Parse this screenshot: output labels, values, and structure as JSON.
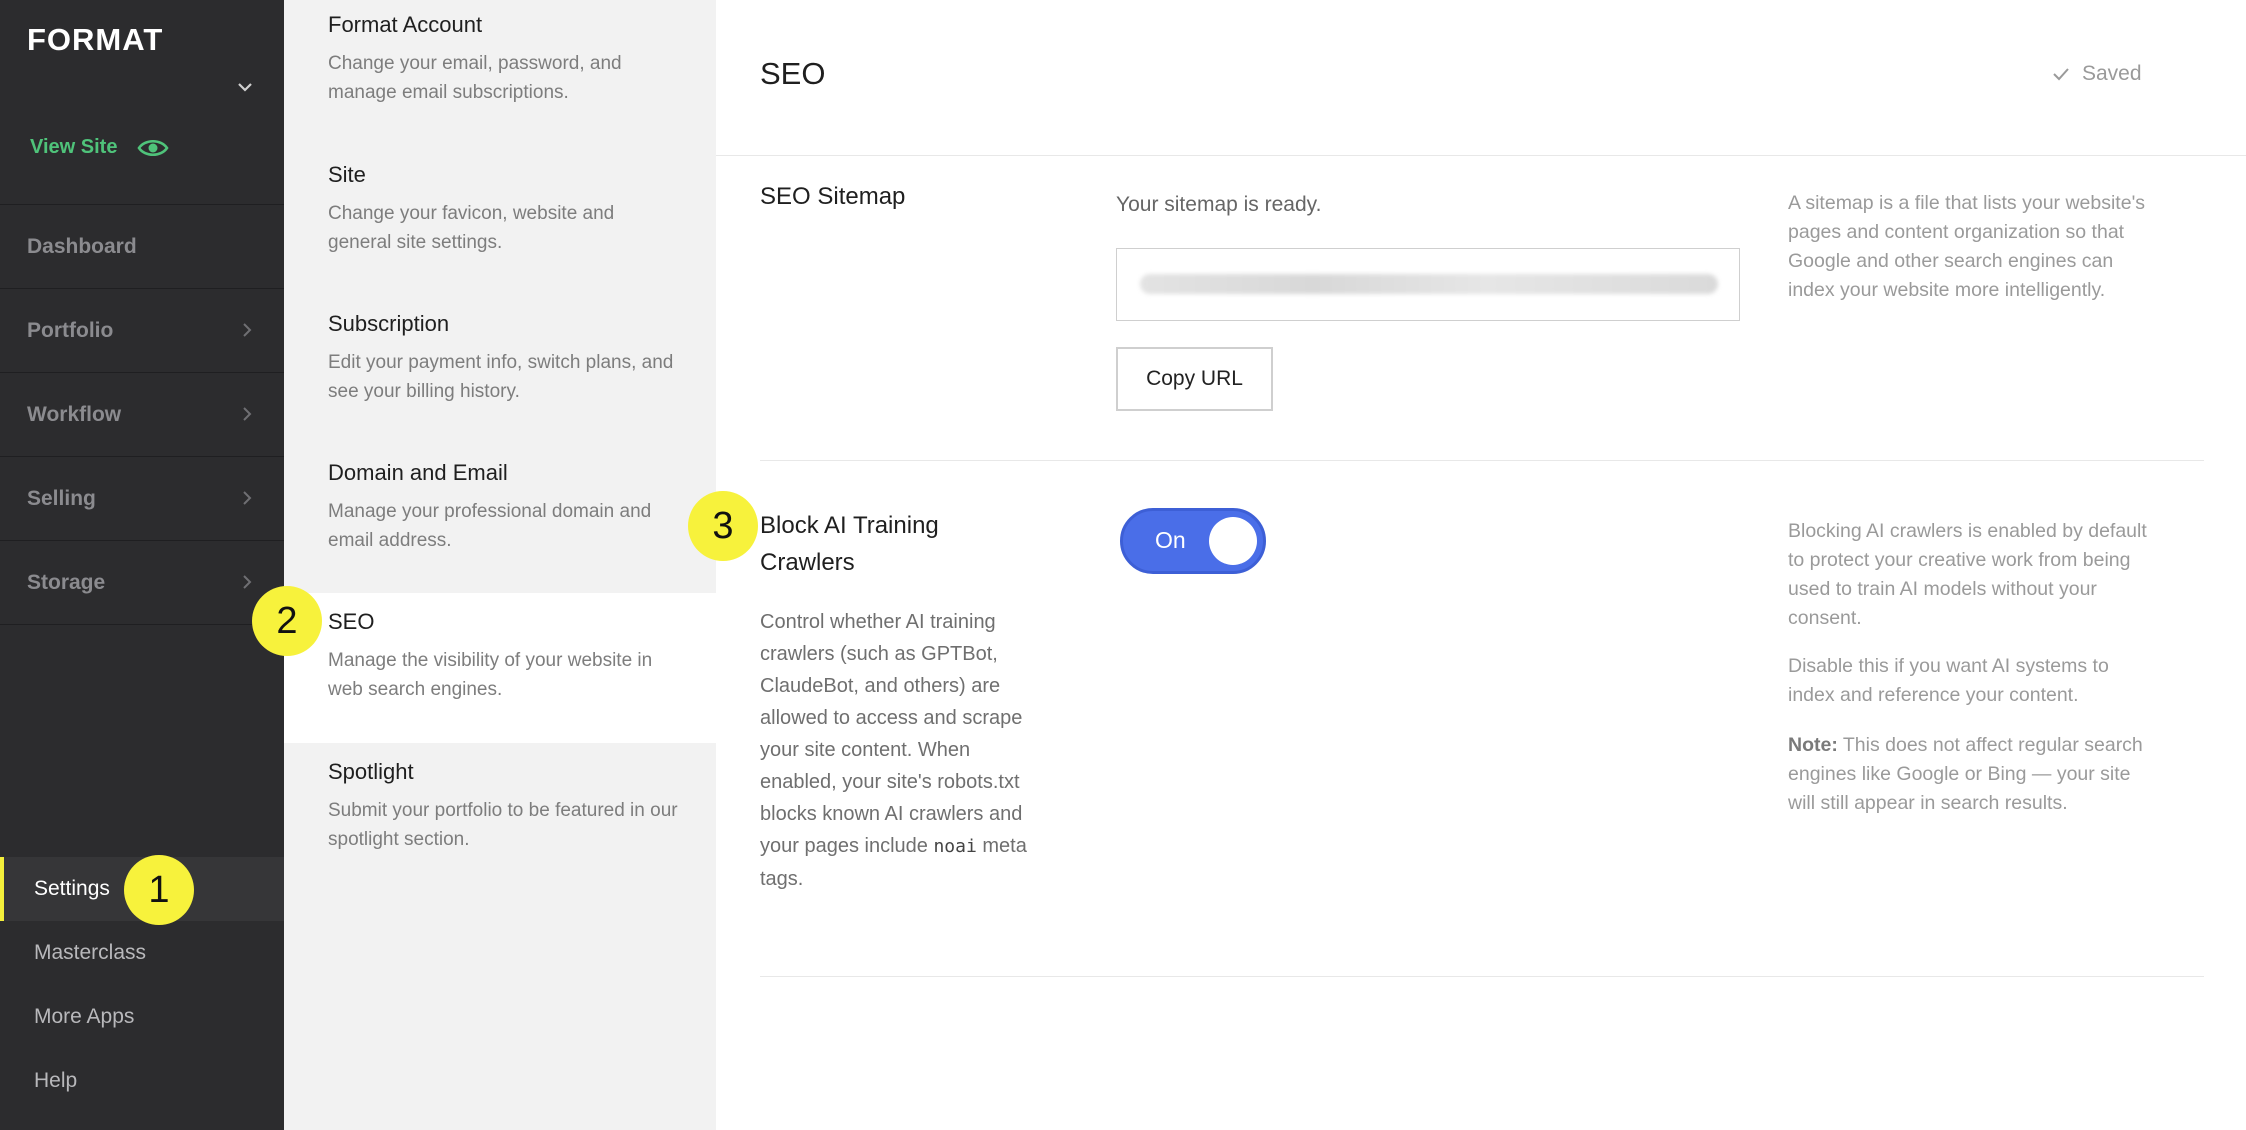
{
  "brand": {
    "logo": "FORMAT",
    "accent_green": "#4fc37a",
    "accent_yellow": "#f4ef3b",
    "toggle_blue": "#4a6ee8"
  },
  "sidebar": {
    "view_site": "View Site",
    "nav": [
      {
        "label": "Dashboard",
        "has_arrow": false
      },
      {
        "label": "Portfolio",
        "has_arrow": true
      },
      {
        "label": "Workflow",
        "has_arrow": true
      },
      {
        "label": "Selling",
        "has_arrow": true
      },
      {
        "label": "Storage",
        "has_arrow": true
      }
    ],
    "bottom": [
      {
        "label": "Settings",
        "active": true
      },
      {
        "label": "Masterclass",
        "active": false
      },
      {
        "label": "More Apps",
        "active": false
      },
      {
        "label": "Help",
        "active": false
      }
    ]
  },
  "settings_menu": [
    {
      "title": "Format Account",
      "desc": "Change your email, password, and manage email subscriptions."
    },
    {
      "title": "Site",
      "desc": "Change your favicon, website and general site settings."
    },
    {
      "title": "Subscription",
      "desc": "Edit your payment info, switch plans, and see your billing history."
    },
    {
      "title": "Domain and Email",
      "desc": "Manage your professional domain and email address."
    },
    {
      "title": "SEO",
      "desc": "Manage the visibility of your website in web search engines.",
      "active": true
    },
    {
      "title": "Spotlight",
      "desc": "Submit your portfolio to be featured in our spotlight section."
    }
  ],
  "main": {
    "title": "SEO",
    "status": "Saved",
    "sitemap": {
      "title": "SEO Sitemap",
      "ready_text": "Your sitemap is ready.",
      "copy_button": "Copy URL",
      "help": "A sitemap is a file that lists your website's pages and content organization so that Google and other search engines can index your website more intelligently."
    },
    "block_ai": {
      "title": "Block AI Training Crawlers",
      "desc_before_code": "Control whether AI training crawlers (such as GPTBot, ClaudeBot, and others) are allowed to access and scrape your site content. When enabled, your site's robots.txt blocks known AI crawlers and your pages include ",
      "code": "noai",
      "desc_after_code": " meta tags.",
      "toggle_label": "On",
      "toggle_on": true,
      "help_1": "Blocking AI crawlers is enabled by default to protect your creative work from being used to train AI models without your consent.",
      "help_2": "Disable this if you want AI systems to index and reference your content.",
      "note_label": "Note:",
      "note_text": " This does not affect regular search engines like Google or Bing — your site will still appear in search results."
    }
  },
  "callouts": [
    "1",
    "2",
    "3"
  ]
}
